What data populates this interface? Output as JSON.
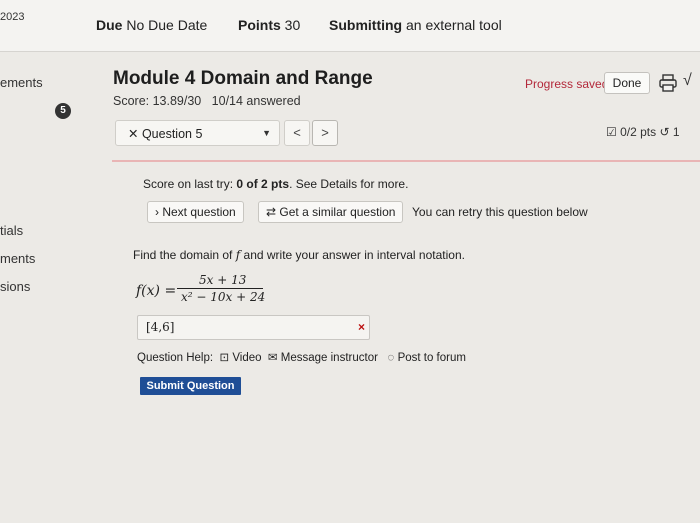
{
  "header": {
    "year_fragment": "2023",
    "due_label": "Due",
    "due_value": "No Due Date",
    "points_label": "Points",
    "points_value": "30",
    "submitting_label": "Submitting",
    "submitting_value": "an external tool"
  },
  "sidebar": {
    "items": [
      {
        "label": "ements"
      },
      {
        "label": "tials"
      },
      {
        "label": "ments"
      },
      {
        "label": "sions"
      }
    ],
    "badge": "5"
  },
  "module": {
    "title": "Module 4 Domain and Range",
    "score": "Score: 13.89/30   10/14 answered",
    "progress": "Progress saved",
    "done_label": "Done",
    "print_icon": "print-icon",
    "sqrt_icon": "√"
  },
  "question_nav": {
    "selected": "Question 5",
    "prev": "<",
    "next": ">",
    "points": "0/2 pts",
    "retry_count": "1"
  },
  "feedback": {
    "score_prefix": "Score on last try: ",
    "score_value": "0 of 2 pts",
    "score_suffix": ". See Details for more.",
    "next_label": "Next question",
    "similar_label": "Get a similar question",
    "retry_text": "You can retry this question below"
  },
  "problem": {
    "prompt_before": "Find the domain of ",
    "prompt_var": "f",
    "prompt_after": " and write your answer in interval notation.",
    "fx": "f(x) =",
    "numerator": "5x + 13",
    "denominator": "x² − 10x + 24"
  },
  "answer": {
    "value": "[4,6]",
    "status_mark": "×"
  },
  "help": {
    "label": "Question Help:",
    "video": "Video",
    "message": "Message instructor",
    "forum": "Post to forum"
  },
  "submit_label": "Submit Question",
  "colors": {
    "accent": "#1f4e96",
    "progress": "#b3283a",
    "wrong": "#bb1111",
    "divider": "#e9b5b5"
  }
}
